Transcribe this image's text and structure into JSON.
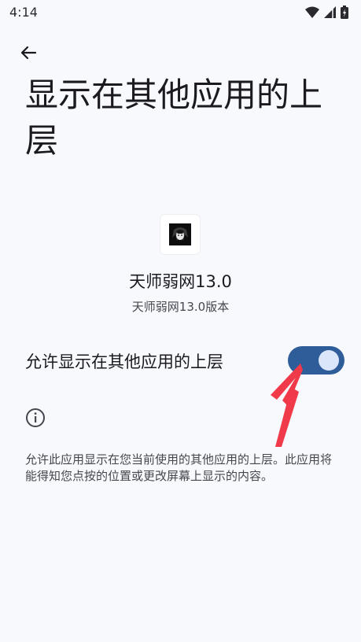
{
  "status_bar": {
    "time": "4:14"
  },
  "page": {
    "title": "显示在其他应用的上层"
  },
  "app": {
    "name": "天师弱网13.0",
    "version": "天师弱网13.0版本"
  },
  "permission": {
    "label": "允许显示在其他应用的上层",
    "enabled": true
  },
  "description": "允许此应用显示在您当前使用的其他应用的上层。此应用将能得知您点按的位置或更改屏幕上显示的内容。",
  "colors": {
    "switch_track": "#2f5d9a",
    "switch_thumb": "#dce6fb",
    "annotation_arrow": "#f03a4a",
    "background": "#f8f9fc"
  }
}
